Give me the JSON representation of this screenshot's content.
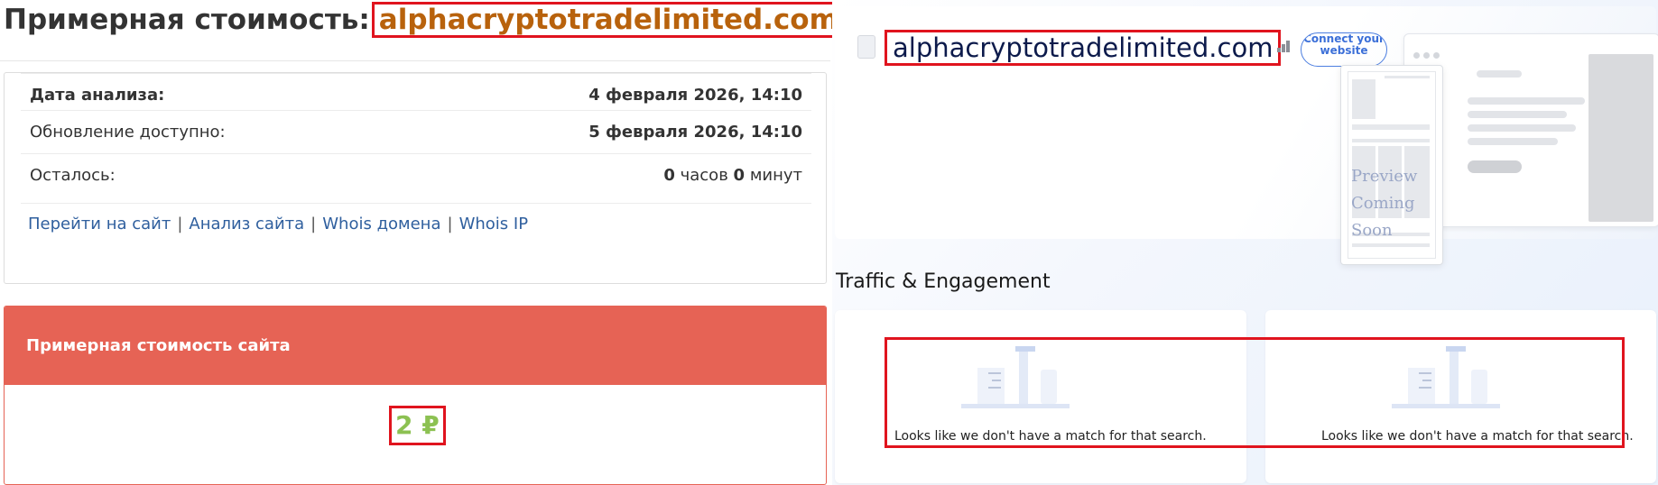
{
  "left": {
    "title_prefix": "Примерная стоимость:",
    "title_domain": "alphacryptotradelimited.com",
    "rows": [
      {
        "label": "Дата анализа:",
        "value": "4 февраля 2026, 14:10"
      },
      {
        "label": "Обновление доступно:",
        "value": "5 февраля 2026, 14:10"
      },
      {
        "label": "Осталось:",
        "hours": "0",
        "hours_unit": "часов",
        "minutes": "0",
        "minutes_unit": "минут"
      }
    ],
    "links": [
      "Перейти на сайт",
      "Анализ сайта",
      "Whois домена",
      "Whois IP"
    ],
    "link_sep": "|",
    "cost_header": "Примерная стоимость сайта",
    "cost_value": "2 ₽"
  },
  "right": {
    "domain": "alphacryptotradelimited.com",
    "connect_label": "Connect your website",
    "preview_line1": "Preview",
    "preview_line2": "Coming Soon",
    "section_title": "Traffic & Engagement",
    "no_match": "Looks like we don't have a match for that search.",
    "no_match_2": "Looks like we don't have a match for that search."
  },
  "colors": {
    "accent_red": "#e66355",
    "price_green": "#8cc152",
    "domain_orange": "#b8620c",
    "link_blue": "#2f5f9e",
    "highlight_box": "#e0141e"
  }
}
